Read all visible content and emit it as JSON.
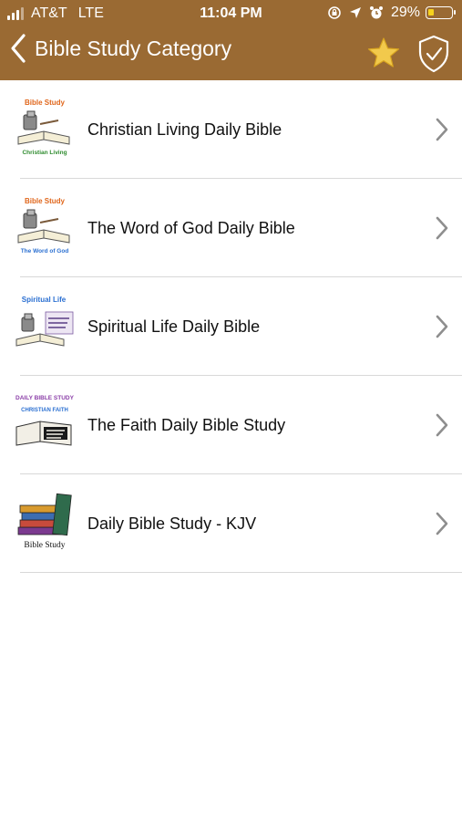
{
  "status_bar": {
    "carrier": "AT&T",
    "network": "LTE",
    "time": "11:04 PM",
    "battery_percent": "29%",
    "battery_level": 0.29,
    "icons": [
      "signal-icon",
      "screen-lock-icon",
      "location-icon",
      "alarm-icon",
      "battery-icon"
    ]
  },
  "nav": {
    "title": "Bible Study Category",
    "back_icon": "chevron-left-icon",
    "actions": [
      "star-icon",
      "shield-check-icon"
    ],
    "color": "#9a6a33",
    "star_color": "#f2c94c"
  },
  "list": {
    "items": [
      {
        "label": "Christian Living Daily Bible",
        "thumb_caption_top": "Bible Study",
        "thumb_caption_bottom": "Christian Living"
      },
      {
        "label": "The Word of God Daily Bible",
        "thumb_caption_top": "Bible Study",
        "thumb_caption_bottom": "The Word of God"
      },
      {
        "label": "Spiritual Life Daily Bible",
        "thumb_caption_top": "Spiritual Life",
        "thumb_caption_bottom": ""
      },
      {
        "label": "The Faith Daily Bible Study",
        "thumb_caption_top": "DAILY BIBLE STUDY",
        "thumb_caption_bottom": "CHRISTIAN FAITH"
      },
      {
        "label": "Daily Bible Study - KJV",
        "thumb_caption_top": "",
        "thumb_caption_bottom": "Bible Study"
      }
    ]
  }
}
